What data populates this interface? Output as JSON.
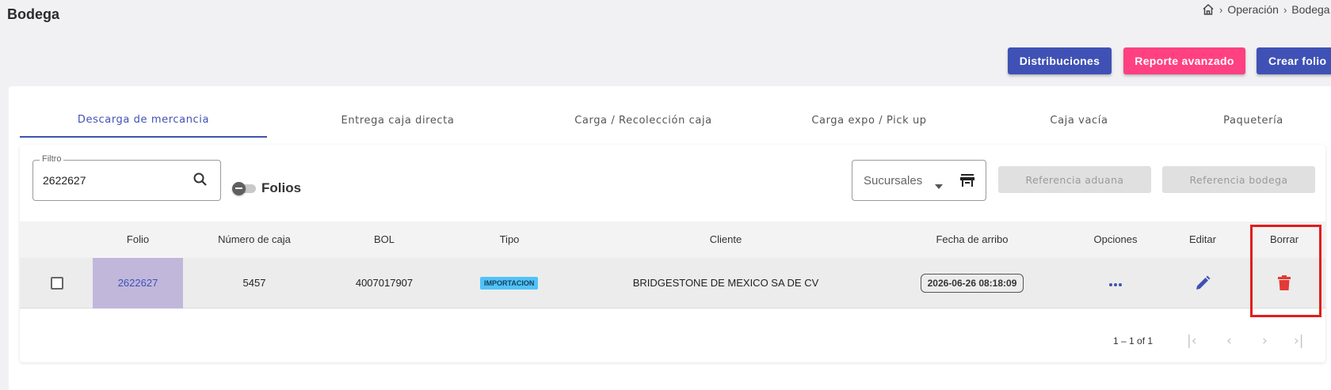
{
  "page": {
    "title": "Bodega"
  },
  "breadcrumb": {
    "items": [
      "Operación",
      "Bodega"
    ]
  },
  "actions": {
    "distribuciones": "Distribuciones",
    "reporte": "Reporte avanzado",
    "crear": "Crear folio"
  },
  "tabs": [
    {
      "label": "Descarga de mercancia",
      "active": true
    },
    {
      "label": "Entrega caja directa",
      "active": false
    },
    {
      "label": "Carga / Recolección caja",
      "active": false
    },
    {
      "label": "Carga expo / Pick up",
      "active": false
    },
    {
      "label": "Caja vacía",
      "active": false
    },
    {
      "label": "Paquetería",
      "active": false
    }
  ],
  "filter": {
    "label": "Filtro",
    "value": "2622627"
  },
  "toggle": {
    "label": "Folios",
    "on": false
  },
  "sucursales": {
    "value": "Sucursales"
  },
  "ref_buttons": {
    "aduana": "Referencia aduana",
    "bodega": "Referencia bodega"
  },
  "table": {
    "columns": [
      "Folio",
      "Número de caja",
      "BOL",
      "Tipo",
      "Cliente",
      "Fecha de arribo",
      "Opciones",
      "Editar",
      "Borrar"
    ],
    "rows": [
      {
        "folio": "2622627",
        "numero_caja": "5457",
        "bol": "4007017907",
        "tipo": "IMPORTACION",
        "cliente": "BRIDGESTONE DE MEXICO SA DE CV",
        "fecha": "2026-06-26 08:18:09"
      }
    ]
  },
  "pagination": {
    "range": "1 – 1 of 1"
  },
  "colors": {
    "primary": "#3f51b5",
    "accent": "#ff4081",
    "delete": "#e53935",
    "highlight": "#e11d1d",
    "tipo_badge": "#4fc3f7"
  },
  "icons": [
    "home-icon",
    "search-icon",
    "store-icon",
    "more-horiz-icon",
    "pencil-icon",
    "trash-icon"
  ]
}
